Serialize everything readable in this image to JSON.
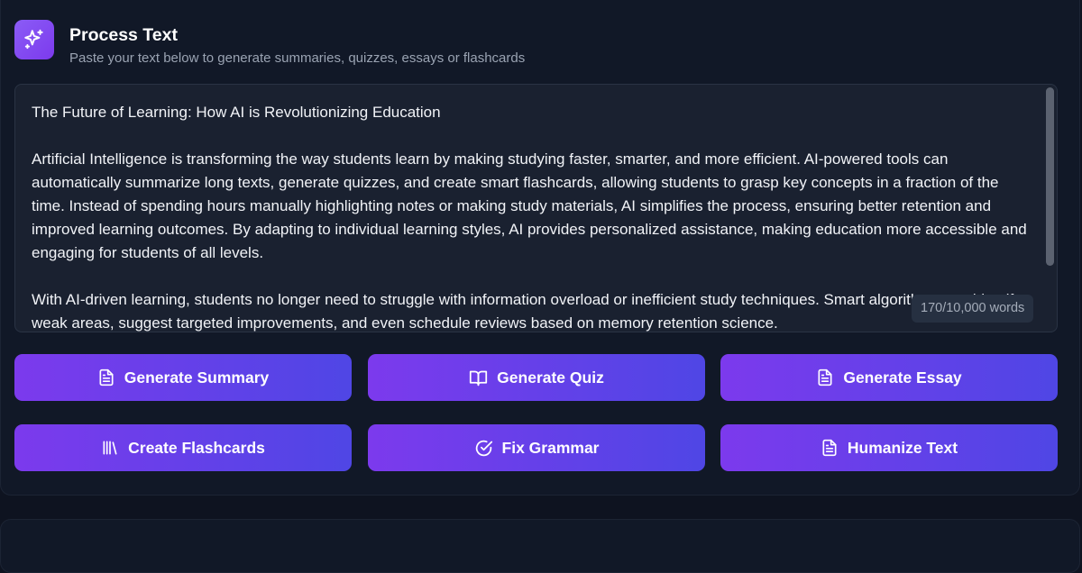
{
  "header": {
    "title": "Process Text",
    "subtitle": "Paste your text below to generate summaries, quizzes, essays or flashcards",
    "icon": "sparkles-icon"
  },
  "editor": {
    "paragraphs": [
      "The Future of Learning: How AI is Revolutionizing Education",
      "Artificial Intelligence is transforming the way students learn by making studying faster, smarter, and more efficient. AI-powered tools can automatically summarize long texts, generate quizzes, and create smart flashcards, allowing students to grasp key concepts in a fraction of the time. Instead of spending hours manually highlighting notes or making study materials, AI simplifies the process, ensuring better retention and improved learning outcomes. By adapting to individual learning styles, AI provides personalized assistance, making education more accessible and engaging for students of all levels.",
      "With AI-driven learning, students no longer need to struggle with information overload or inefficient study techniques. Smart algorithms can identify weak areas, suggest targeted improvements, and even schedule reviews based on memory retention science."
    ],
    "word_count": "170/10,000 words"
  },
  "actions": {
    "generate_summary": {
      "label": "Generate Summary",
      "icon": "document-icon"
    },
    "generate_quiz": {
      "label": "Generate Quiz",
      "icon": "book-open-icon"
    },
    "generate_essay": {
      "label": "Generate Essay",
      "icon": "document-icon"
    },
    "create_flashcards": {
      "label": "Create Flashcards",
      "icon": "library-icon"
    },
    "fix_grammar": {
      "label": "Fix Grammar",
      "icon": "check-circle-icon"
    },
    "humanize_text": {
      "label": "Humanize Text",
      "icon": "document-icon"
    }
  },
  "colors": {
    "background": "#0e1320",
    "card": "#111827",
    "button_gradient_start": "#7c3aed",
    "button_gradient_end": "#4f46e5"
  }
}
